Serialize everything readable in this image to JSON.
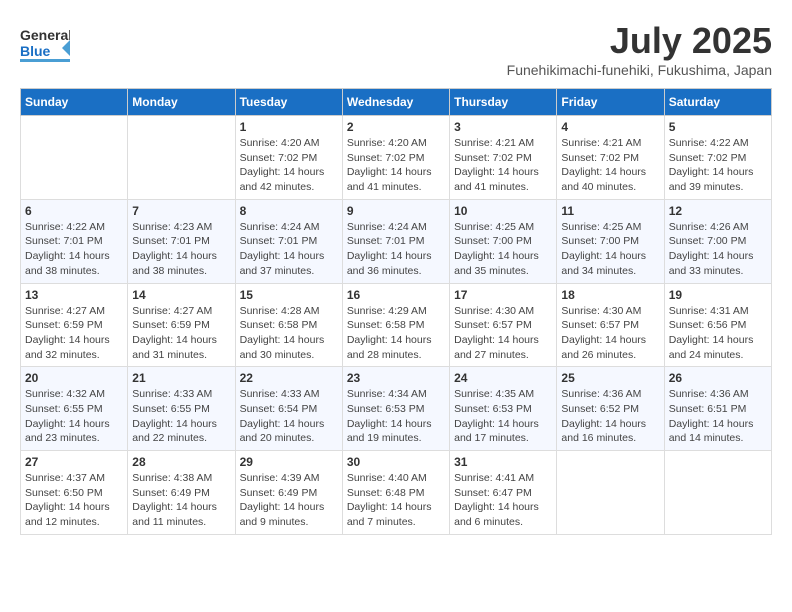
{
  "header": {
    "logo_general": "General",
    "logo_blue": "Blue",
    "month": "July 2025",
    "location": "Funehikimachi-funehiki, Fukushima, Japan"
  },
  "weekdays": [
    "Sunday",
    "Monday",
    "Tuesday",
    "Wednesday",
    "Thursday",
    "Friday",
    "Saturday"
  ],
  "weeks": [
    [
      {
        "day": "",
        "content": ""
      },
      {
        "day": "",
        "content": ""
      },
      {
        "day": "1",
        "content": "Sunrise: 4:20 AM\nSunset: 7:02 PM\nDaylight: 14 hours and 42 minutes."
      },
      {
        "day": "2",
        "content": "Sunrise: 4:20 AM\nSunset: 7:02 PM\nDaylight: 14 hours and 41 minutes."
      },
      {
        "day": "3",
        "content": "Sunrise: 4:21 AM\nSunset: 7:02 PM\nDaylight: 14 hours and 41 minutes."
      },
      {
        "day": "4",
        "content": "Sunrise: 4:21 AM\nSunset: 7:02 PM\nDaylight: 14 hours and 40 minutes."
      },
      {
        "day": "5",
        "content": "Sunrise: 4:22 AM\nSunset: 7:02 PM\nDaylight: 14 hours and 39 minutes."
      }
    ],
    [
      {
        "day": "6",
        "content": "Sunrise: 4:22 AM\nSunset: 7:01 PM\nDaylight: 14 hours and 38 minutes."
      },
      {
        "day": "7",
        "content": "Sunrise: 4:23 AM\nSunset: 7:01 PM\nDaylight: 14 hours and 38 minutes."
      },
      {
        "day": "8",
        "content": "Sunrise: 4:24 AM\nSunset: 7:01 PM\nDaylight: 14 hours and 37 minutes."
      },
      {
        "day": "9",
        "content": "Sunrise: 4:24 AM\nSunset: 7:01 PM\nDaylight: 14 hours and 36 minutes."
      },
      {
        "day": "10",
        "content": "Sunrise: 4:25 AM\nSunset: 7:00 PM\nDaylight: 14 hours and 35 minutes."
      },
      {
        "day": "11",
        "content": "Sunrise: 4:25 AM\nSunset: 7:00 PM\nDaylight: 14 hours and 34 minutes."
      },
      {
        "day": "12",
        "content": "Sunrise: 4:26 AM\nSunset: 7:00 PM\nDaylight: 14 hours and 33 minutes."
      }
    ],
    [
      {
        "day": "13",
        "content": "Sunrise: 4:27 AM\nSunset: 6:59 PM\nDaylight: 14 hours and 32 minutes."
      },
      {
        "day": "14",
        "content": "Sunrise: 4:27 AM\nSunset: 6:59 PM\nDaylight: 14 hours and 31 minutes."
      },
      {
        "day": "15",
        "content": "Sunrise: 4:28 AM\nSunset: 6:58 PM\nDaylight: 14 hours and 30 minutes."
      },
      {
        "day": "16",
        "content": "Sunrise: 4:29 AM\nSunset: 6:58 PM\nDaylight: 14 hours and 28 minutes."
      },
      {
        "day": "17",
        "content": "Sunrise: 4:30 AM\nSunset: 6:57 PM\nDaylight: 14 hours and 27 minutes."
      },
      {
        "day": "18",
        "content": "Sunrise: 4:30 AM\nSunset: 6:57 PM\nDaylight: 14 hours and 26 minutes."
      },
      {
        "day": "19",
        "content": "Sunrise: 4:31 AM\nSunset: 6:56 PM\nDaylight: 14 hours and 24 minutes."
      }
    ],
    [
      {
        "day": "20",
        "content": "Sunrise: 4:32 AM\nSunset: 6:55 PM\nDaylight: 14 hours and 23 minutes."
      },
      {
        "day": "21",
        "content": "Sunrise: 4:33 AM\nSunset: 6:55 PM\nDaylight: 14 hours and 22 minutes."
      },
      {
        "day": "22",
        "content": "Sunrise: 4:33 AM\nSunset: 6:54 PM\nDaylight: 14 hours and 20 minutes."
      },
      {
        "day": "23",
        "content": "Sunrise: 4:34 AM\nSunset: 6:53 PM\nDaylight: 14 hours and 19 minutes."
      },
      {
        "day": "24",
        "content": "Sunrise: 4:35 AM\nSunset: 6:53 PM\nDaylight: 14 hours and 17 minutes."
      },
      {
        "day": "25",
        "content": "Sunrise: 4:36 AM\nSunset: 6:52 PM\nDaylight: 14 hours and 16 minutes."
      },
      {
        "day": "26",
        "content": "Sunrise: 4:36 AM\nSunset: 6:51 PM\nDaylight: 14 hours and 14 minutes."
      }
    ],
    [
      {
        "day": "27",
        "content": "Sunrise: 4:37 AM\nSunset: 6:50 PM\nDaylight: 14 hours and 12 minutes."
      },
      {
        "day": "28",
        "content": "Sunrise: 4:38 AM\nSunset: 6:49 PM\nDaylight: 14 hours and 11 minutes."
      },
      {
        "day": "29",
        "content": "Sunrise: 4:39 AM\nSunset: 6:49 PM\nDaylight: 14 hours and 9 minutes."
      },
      {
        "day": "30",
        "content": "Sunrise: 4:40 AM\nSunset: 6:48 PM\nDaylight: 14 hours and 7 minutes."
      },
      {
        "day": "31",
        "content": "Sunrise: 4:41 AM\nSunset: 6:47 PM\nDaylight: 14 hours and 6 minutes."
      },
      {
        "day": "",
        "content": ""
      },
      {
        "day": "",
        "content": ""
      }
    ]
  ]
}
